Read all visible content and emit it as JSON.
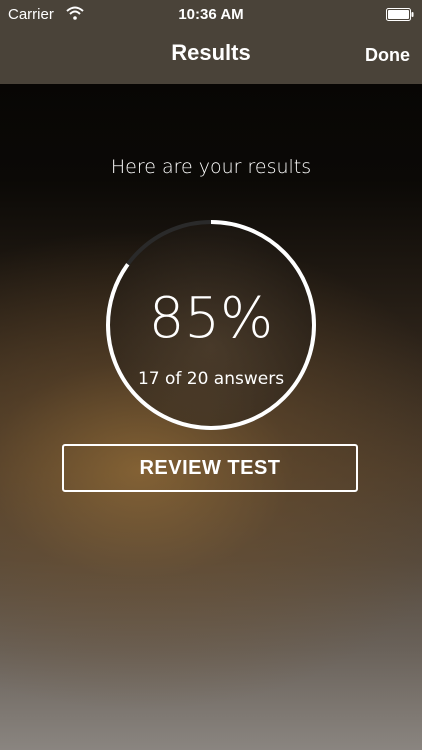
{
  "status_bar": {
    "carrier": "Carrier",
    "time": "10:36 AM",
    "icons": [
      "wifi-icon",
      "battery-icon"
    ]
  },
  "nav": {
    "title": "Results",
    "done_label": "Done"
  },
  "results": {
    "heading": "Here are your results",
    "percent_text": "85%",
    "detail_text": "17 of 20 answers",
    "score_fraction": 0.85
  },
  "actions": {
    "review_label": "REVIEW TEST"
  },
  "colors": {
    "bar_background": "#4a4339",
    "ring": "#ffffff",
    "ring_track": "#2a2a2a"
  }
}
